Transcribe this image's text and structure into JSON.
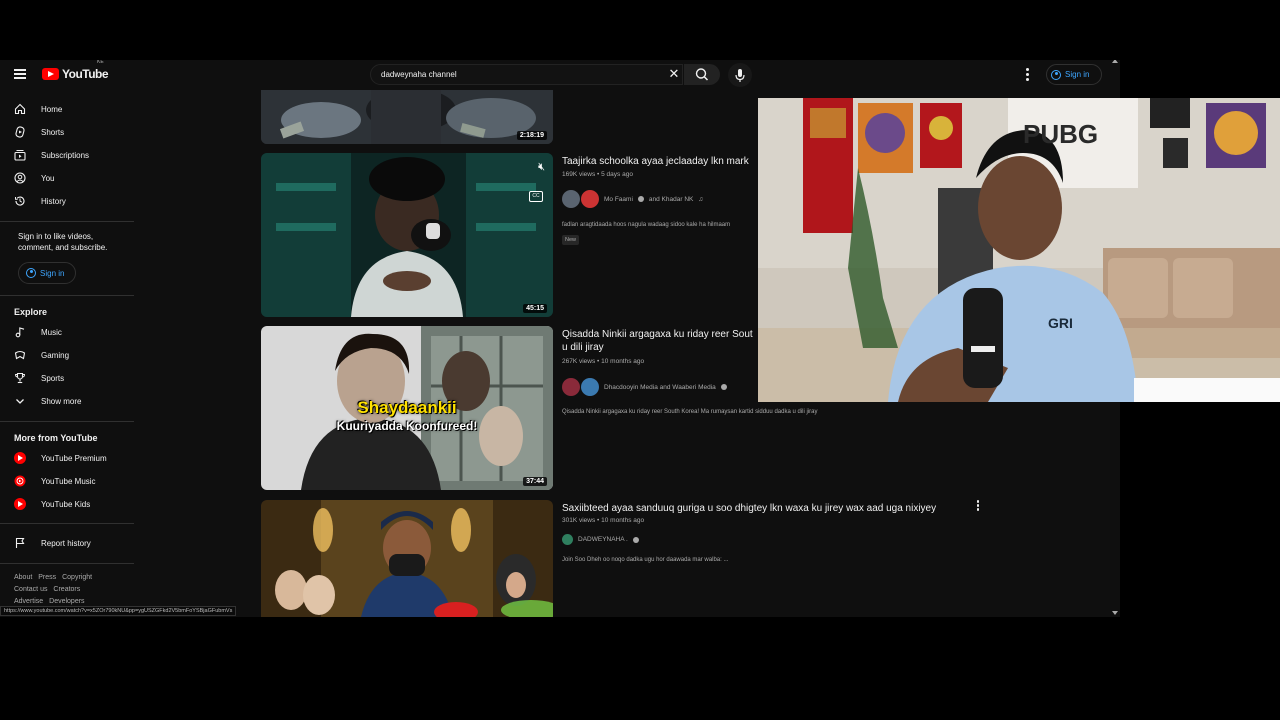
{
  "topbar": {
    "logo_text": "YouTube",
    "country_code": "KE",
    "search_value": "dadweynaha channel",
    "signin_label": "Sign in"
  },
  "sidebar": {
    "main": [
      {
        "label": "Home",
        "icon": "home-icon"
      },
      {
        "label": "Shorts",
        "icon": "shorts-icon"
      },
      {
        "label": "Subscriptions",
        "icon": "subscriptions-icon"
      },
      {
        "label": "You",
        "icon": "you-icon"
      },
      {
        "label": "History",
        "icon": "history-icon"
      }
    ],
    "signin_note": "Sign in to like videos, comment, and subscribe.",
    "signin_label": "Sign in",
    "explore_title": "Explore",
    "explore": [
      {
        "label": "Music",
        "icon": "music-icon"
      },
      {
        "label": "Gaming",
        "icon": "gaming-icon"
      },
      {
        "label": "Sports",
        "icon": "trophy-icon"
      },
      {
        "label": "Show more",
        "icon": "chevron-down-icon"
      }
    ],
    "more_title": "More from YouTube",
    "more": [
      {
        "label": "YouTube Premium",
        "icon": "youtube-premium-icon"
      },
      {
        "label": "YouTube Music",
        "icon": "youtube-music-icon"
      },
      {
        "label": "YouTube Kids",
        "icon": "youtube-kids-icon"
      }
    ],
    "report_history": "Report history",
    "footer": [
      "About",
      "Press",
      "Copyright",
      "Contact us",
      "Creators",
      "Advertise",
      "Developers"
    ]
  },
  "results": [
    {
      "duration": "2:18:19"
    },
    {
      "title": "Taajirka schoolka ayaa jeclaaday lkn mark",
      "meta": "169K views • 5 days ago",
      "channel": "Mo Faami",
      "channel_suffix": "and Khadar NK",
      "description": "fadlan aragtidaada hoos nagula wadaag sidoo kale ha hilmaam",
      "badge": "New",
      "duration": "45:15"
    },
    {
      "title_line1": "Qisadda Ninkii argagaxa ku riday reer Sout",
      "title_line2": "u dili jiray",
      "meta": "267K views • 10 months ago",
      "channel": "Dhacdooyin Media and Waaberi Media",
      "description": "Qisadda Ninkii argagaxa ku riday reer South Korea! Ma rumaysan kartid sidduu dadka u dili jiray",
      "duration": "37:44",
      "thumb_text1": "Shaydaankii",
      "thumb_text2": "Kuuriyadda Koonfureed!"
    },
    {
      "title": "Saxiibteed ayaa sanduuq guriga u soo dhigtey lkn waxa ku jirey wax aad uga nixiyey",
      "meta": "301K views • 10 months ago",
      "channel": "DADWEYNAHA .",
      "description": "Join Soo Dheh oo noqo dadka ugu hor daawada mar walba: ..."
    }
  ],
  "statusbar_url": "https://www.youtube.com/watch?v=x5ZOr790kNU&pp=ygUSZGFkd2V5bmFoYSBjaGFubmVs",
  "webcam": {
    "shirt_text": "GRI",
    "banner_text": "PUBG"
  },
  "colors": {
    "accent_blue": "#3ea6ff",
    "brand_red": "#ff0000",
    "background": "#0f0f0f"
  }
}
